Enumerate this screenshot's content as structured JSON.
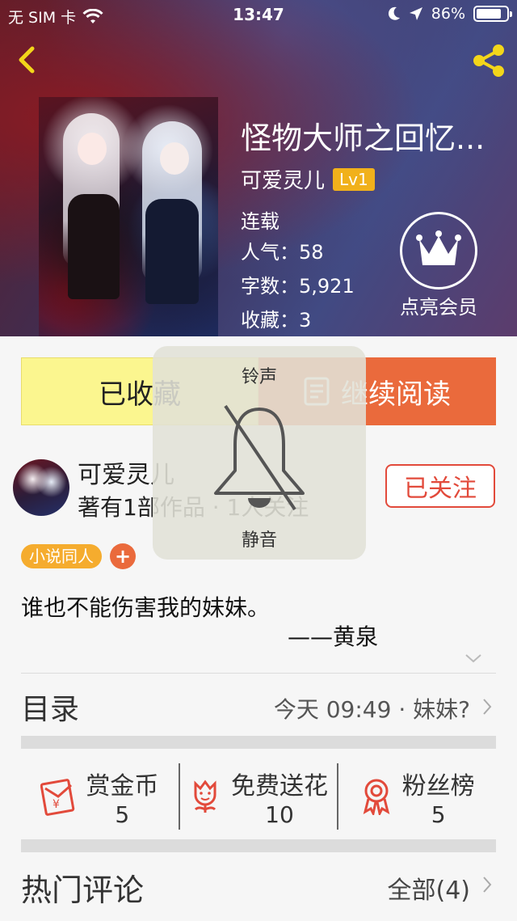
{
  "status_bar": {
    "carrier": "无 SIM 卡",
    "time": "13:47",
    "battery_text": "86%",
    "battery_level": 0.86
  },
  "book": {
    "title": "怪物大师之回忆...",
    "author": "可爱灵儿",
    "level": "Lv1",
    "status": "连载",
    "popularity_label": "人气：",
    "popularity": "58",
    "words_label": "字数：",
    "words": "5,921",
    "favorites_label": "收藏：",
    "favorites": "3"
  },
  "vip": {
    "label": "点亮会员"
  },
  "actions": {
    "collected_label": "已收藏",
    "continue_label": "继续阅读"
  },
  "author_section": {
    "name": "可爱灵儿",
    "works": "著有1部作品 · 1人关注",
    "follow_label": "已关注"
  },
  "tags": {
    "items": [
      "小说同人"
    ],
    "add_symbol": "+"
  },
  "description": {
    "line1": "谁也不能伤害我的妹妹。",
    "line2": "——黄泉"
  },
  "toc": {
    "title": "目录",
    "latest": "今天 09:49 · 妹妹?"
  },
  "stats": [
    {
      "name": "赏金币",
      "value": "5",
      "icon": "red-envelope-icon"
    },
    {
      "name": "免费送花",
      "value": "10",
      "icon": "flower-icon"
    },
    {
      "name": "粉丝榜",
      "value": "5",
      "icon": "ribbon-medal-icon"
    }
  ],
  "comments": {
    "title": "热门评论",
    "all_label": "全部(4)"
  },
  "hud": {
    "title": "铃声",
    "status": "静音"
  },
  "colors": {
    "accent_orange": "#ea6a3c",
    "collected_yellow": "#fbf68f",
    "follow_red": "#e24a3b",
    "level_badge": "#f1b11b",
    "tag_orange": "#f5ac2e",
    "icon_red": "#e24a3b"
  }
}
